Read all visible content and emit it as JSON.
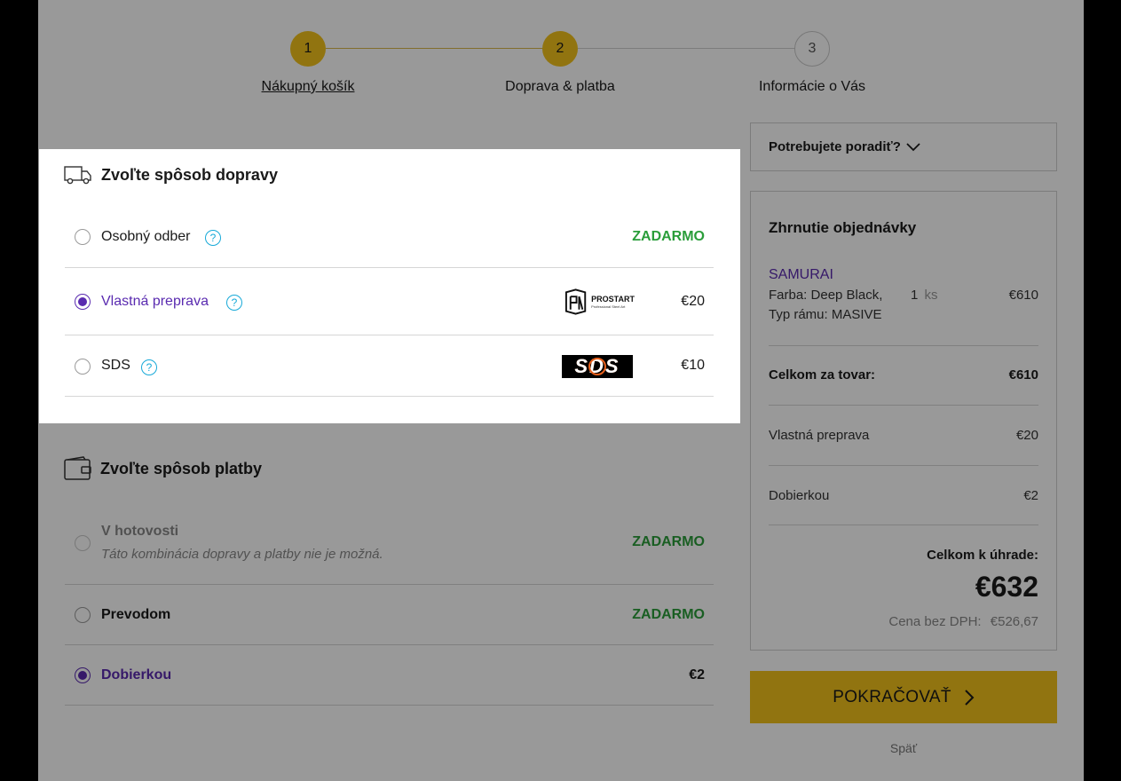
{
  "stepper": {
    "steps": [
      {
        "number": "1",
        "label": "Nákupný košík"
      },
      {
        "number": "2",
        "label": "Doprava & platba"
      },
      {
        "number": "3",
        "label": "Informácie o Vás"
      }
    ]
  },
  "shipping": {
    "title": "Zvoľte spôsob dopravy",
    "options": [
      {
        "label": "Osobný odber",
        "price": "ZADARMO",
        "help": "?"
      },
      {
        "label": "Vlastná preprava",
        "price": "€20",
        "help": "?",
        "logo_text": "PROSTART",
        "logo_subtext": "Professional Steel Art"
      },
      {
        "label": "SDS",
        "price": "€10",
        "help": "?",
        "logo_text": "SDS"
      }
    ]
  },
  "payment": {
    "title": "Zvoľte spôsob platby",
    "options": [
      {
        "label": "V hotovosti",
        "note": "Táto kombinácia dopravy a platby nie je možná.",
        "price": "ZADARMO"
      },
      {
        "label": "Prevodom",
        "price": "ZADARMO"
      },
      {
        "label": "Dobierkou",
        "price": "€2"
      }
    ]
  },
  "advice": {
    "label": "Potrebujete poradiť?"
  },
  "summary": {
    "title": "Zhrnutie objednávky",
    "product": {
      "name": "SAMURAI",
      "attr1": "Farba: Deep Black,",
      "attr2": "Typ rámu: MASIVE",
      "qty": "1",
      "qty_unit": "ks",
      "price": "€610"
    },
    "goods_total_label": "Celkom za tovar:",
    "goods_total_value": "€610",
    "shipping_label": "Vlastná preprava",
    "shipping_value": "€20",
    "payment_label": "Dobierkou",
    "payment_value": "€2",
    "total_label": "Celkom k úhrade:",
    "total_value": "€632",
    "net_label": "Cena bez DPH:",
    "net_value": "€526,67"
  },
  "actions": {
    "continue_label": "POKRAČOVAŤ",
    "back_label": "Späť"
  },
  "colors": {
    "accent_yellow": "#f2c21b",
    "selected_purple": "#5a2bb0",
    "free_green": "#2a9d3a",
    "help_blue": "#17a9d8"
  }
}
